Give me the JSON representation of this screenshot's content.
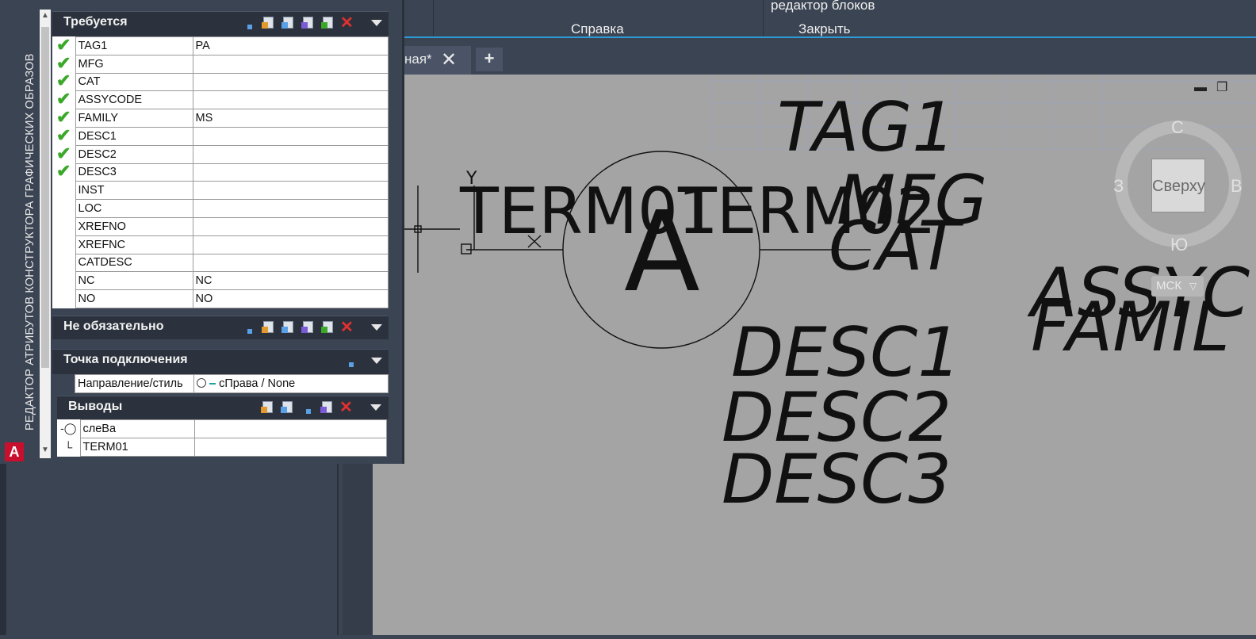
{
  "ribbon": {
    "help_label": "Справка",
    "block_editor_label": "редактор блоков",
    "close_label": "Закрыть"
  },
  "tabs": {
    "active_tab_label": "ная*",
    "close_glyph": "✕",
    "new_tab_glyph": "+"
  },
  "palette": {
    "vertical_title": "РЕДАКТОР АТРИБУТОВ КОНСТРУКТОРА ГРАФИЧЕСКИХ ОБРАЗОВ",
    "app_icon": "A",
    "required_section": {
      "title": "Требуется",
      "rows": [
        {
          "name": "TAG1",
          "value": "PA",
          "checked": true
        },
        {
          "name": "MFG",
          "value": "",
          "checked": true
        },
        {
          "name": "CAT",
          "value": "",
          "checked": true
        },
        {
          "name": "ASSYCODE",
          "value": "",
          "checked": true
        },
        {
          "name": "FAMILY",
          "value": "MS",
          "checked": true
        },
        {
          "name": "DESC1",
          "value": "",
          "checked": true
        },
        {
          "name": "DESC2",
          "value": "",
          "checked": true
        },
        {
          "name": "DESC3",
          "value": "",
          "checked": true
        },
        {
          "name": "INST",
          "value": "",
          "checked": false
        },
        {
          "name": "LOC",
          "value": "",
          "checked": false
        },
        {
          "name": "XREFNO",
          "value": "",
          "checked": false
        },
        {
          "name": "XREFNC",
          "value": "",
          "checked": false
        },
        {
          "name": "CATDESC",
          "value": "",
          "checked": false
        },
        {
          "name": "NC",
          "value": "NC",
          "checked": false
        },
        {
          "name": "NO",
          "value": "NO",
          "checked": false
        }
      ]
    },
    "optional_section": {
      "title": "Не обязательно"
    },
    "connection_section": {
      "title": "Точка подключения",
      "direction_label": "Направление/стиль",
      "direction_value": "сПрава / None"
    },
    "pins_section": {
      "title": "Выводы",
      "rows": [
        {
          "name": "слеВа",
          "value": ""
        },
        {
          "name": "TERM01",
          "value": ""
        }
      ]
    }
  },
  "viewcube": {
    "top_face": "Сверху",
    "north": "С",
    "south": "Ю",
    "west": "З",
    "east": "В",
    "wcs": "МСК"
  },
  "drawing": {
    "texts": [
      "TAG1",
      "MFG",
      "CAT",
      "ASSYC",
      "FAMIL",
      "DESC1",
      "DESC2",
      "DESC3",
      "TERM01",
      "TERM02",
      "A",
      "Y",
      "X"
    ]
  },
  "colors": {
    "panel_bg": "#3b4453",
    "section_header": "#2c323d",
    "canvas": "#a4a4a4",
    "accent_line": "#2e9ad6",
    "check_green": "#3aa829",
    "delete_red": "#e23030"
  }
}
